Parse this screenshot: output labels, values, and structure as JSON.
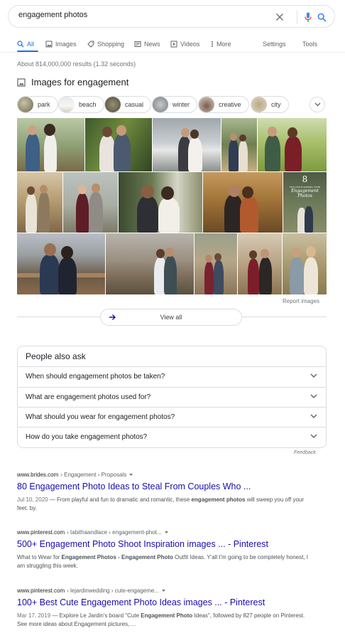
{
  "search": {
    "query": "engagement photos"
  },
  "tabs": {
    "all": "All",
    "images": "Images",
    "shopping": "Shopping",
    "news": "News",
    "videos": "Videos",
    "more": "More",
    "settings": "Settings",
    "tools": "Tools"
  },
  "stats": "About 814,000,000 results (1.32 seconds)",
  "images_section": {
    "title": "Images for engagement",
    "chips": [
      "park",
      "beach",
      "casual",
      "winter",
      "creative",
      "city"
    ],
    "report": "Report images",
    "view_all": "View all",
    "photo_overlay": {
      "number": "8",
      "line1": "TIPS FOR PLANNING YOUR",
      "line2": "Engagement",
      "line3": "Photos"
    }
  },
  "people_also_ask": {
    "title": "People also ask",
    "questions": [
      "When should engagement photos be taken?",
      "What are engagement photos used for?",
      "What should you wear for engagement photos?",
      "How do you take engagement photos?"
    ],
    "feedback": "Feedback"
  },
  "results": [
    {
      "domain": "www.brides.com",
      "path": "› Engagement › Proposals",
      "title": "80 Engagement Photo Ideas to Steal From Couples Who ...",
      "date": "Jul 10, 2020",
      "snippet_a": " — From playful and fun to dramatic and romantic, these ",
      "snippet_b1": "engagement photos",
      "snippet_c": " will sweep you off your feet. by."
    },
    {
      "domain": "www.pinterest.com",
      "path": "› tabithaandlace › engagement-phot...",
      "title": "500+ Engagement Photo Shoot Inspiration images ... - Pinterest",
      "snippet_a": "What to Wear for ",
      "snippet_b1": "Engagement Photos - Engagement Photo",
      "snippet_c": " Outfit Ideas. Y'all I'm going to be completely honest, I am struggling this week."
    },
    {
      "domain": "www.pinterest.com",
      "path": "› lejardinwedding › cute-engageme...",
      "title": "100+ Best Cute Engagement Photo Ideas images ... - Pinterest",
      "date": "Mar 17, 2019",
      "snippet_a": " — Explore Le Jardin's board \"Cute ",
      "snippet_b1": "Engagement Photo",
      "snippet_c": " Ideas\", followed by 827 people on Pinterest. See more ideas about Engagement pictures, ..."
    }
  ],
  "colors": {
    "accent": "#1a73e8",
    "link": "#1a0dab",
    "mic_red": "#ea4335",
    "mic_blue": "#4285f4"
  }
}
